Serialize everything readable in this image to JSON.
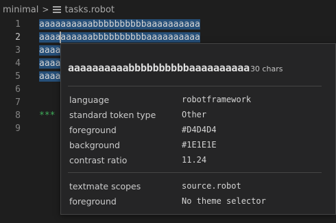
{
  "breadcrumb": {
    "folder": "minimal",
    "separator": ">",
    "file": "tasks.robot",
    "file_icon": "list-icon"
  },
  "editor": {
    "lines": [
      {
        "num": "1",
        "text": "aaaaaaaaaabbbbbbbbbbaaaaaaaaaa"
      },
      {
        "num": "2",
        "text": "aaaaaaaaaabbbbbbbbbbaaaaaaaaaa"
      },
      {
        "num": "3",
        "text": "aaaa"
      },
      {
        "num": "4",
        "text": "aaaa"
      },
      {
        "num": "5",
        "text": "aaaa"
      },
      {
        "num": "6",
        "text": ""
      },
      {
        "num": "7",
        "text": ""
      },
      {
        "num": "8",
        "text": "***"
      },
      {
        "num": "9",
        "text": ""
      }
    ],
    "active_line": "2"
  },
  "hover": {
    "token": "aaaaaaaaaabbbbbbbbbbaaaaaaaaaa",
    "char_count": "30 chars",
    "rows": [
      {
        "key": "language",
        "value": "robotframework"
      },
      {
        "key": "standard token type",
        "value": "Other"
      },
      {
        "key": "foreground",
        "value": "#D4D4D4"
      },
      {
        "key": "background",
        "value": "#1E1E1E"
      },
      {
        "key": "contrast ratio",
        "value": "11.24"
      }
    ],
    "scope_rows": [
      {
        "key": "textmate scopes",
        "value": "source.robot"
      },
      {
        "key": "foreground",
        "value": "No theme selector"
      }
    ]
  },
  "colors": {
    "background": "#1e1e1e",
    "selection": "#264f78",
    "keyword": "#3fae5a",
    "hover_bg": "#252526"
  }
}
